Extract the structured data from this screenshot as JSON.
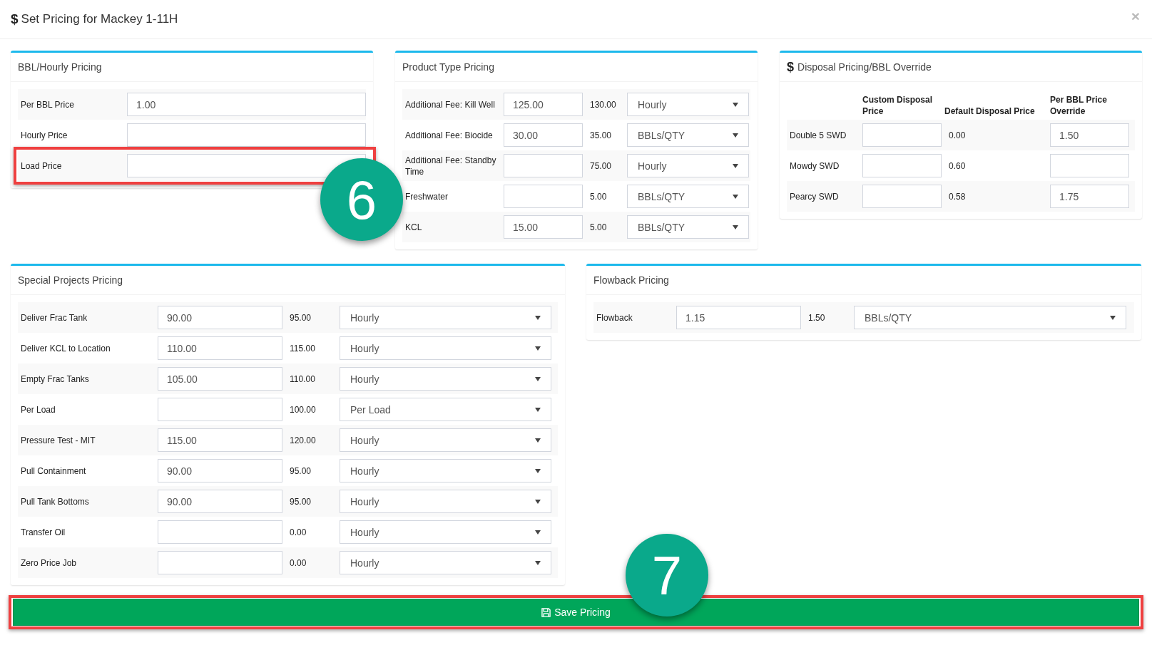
{
  "modal": {
    "title_icon": "$",
    "title": "Set Pricing for Mackey 1-11H",
    "close": "×"
  },
  "bbl_hourly_pricing": {
    "title": "BBL/Hourly Pricing",
    "rows": [
      {
        "label": "Per BBL Price",
        "value": "1.00",
        "highlighted": false
      },
      {
        "label": "Hourly Price",
        "highlighted": false
      },
      {
        "label": "Load Price",
        "highlighted": true
      }
    ]
  },
  "product_type_pricing": {
    "title": "Product Type Pricing",
    "rows": [
      {
        "label": "Additional Fee: Kill Well",
        "value": "125.00",
        "default": "130.00",
        "unit": "Hourly"
      },
      {
        "label": "Additional Fee: Biocide",
        "value": "30.00",
        "default": "35.00",
        "unit": "BBLs/QTY"
      },
      {
        "label": "Additional Fee: Standby Time",
        "default": "75.00",
        "unit": "Hourly"
      },
      {
        "label": "Freshwater",
        "default": "5.00",
        "unit": "BBLs/QTY"
      },
      {
        "label": "KCL",
        "value": "15.00",
        "default": "5.00",
        "unit": "BBLs/QTY"
      }
    ]
  },
  "disposal_pricing": {
    "title_icon": "$",
    "title": "Disposal Pricing/BBL Override",
    "columns": [
      "Custom Disposal Price",
      "Default Disposal Price",
      "Per BBL Price Override"
    ],
    "rows": [
      {
        "name": "Double 5 SWD",
        "default": "0.00",
        "override": "1.50"
      },
      {
        "name": "Mowdy SWD",
        "default": "0.60"
      },
      {
        "name": "Pearcy SWD",
        "default": "0.58",
        "override": "1.75"
      }
    ]
  },
  "special_projects_pricing": {
    "title": "Special Projects Pricing",
    "rows": [
      {
        "label": "Deliver Frac Tank",
        "value": "90.00",
        "default": "95.00",
        "unit": "Hourly"
      },
      {
        "label": "Deliver KCL to Location",
        "value": "110.00",
        "default": "115.00",
        "unit": "Hourly"
      },
      {
        "label": "Empty Frac Tanks",
        "value": "105.00",
        "default": "110.00",
        "unit": "Hourly"
      },
      {
        "label": "Per Load",
        "default": "100.00",
        "unit": "Per Load"
      },
      {
        "label": "Pressure Test - MIT",
        "value": "115.00",
        "default": "120.00",
        "unit": "Hourly"
      },
      {
        "label": "Pull Containment",
        "value": "90.00",
        "default": "95.00",
        "unit": "Hourly"
      },
      {
        "label": "Pull Tank Bottoms",
        "value": "90.00",
        "default": "95.00",
        "unit": "Hourly"
      },
      {
        "label": "Transfer Oil",
        "default": "0.00",
        "unit": "Hourly"
      },
      {
        "label": "Zero Price Job",
        "default": "0.00",
        "unit": "Hourly"
      }
    ]
  },
  "flowback_pricing": {
    "title": "Flowback Pricing",
    "rows": [
      {
        "label": "Flowback",
        "value": "1.15",
        "default": "1.50",
        "unit": "BBLs/QTY"
      }
    ]
  },
  "save_button": {
    "label": "Save Pricing",
    "highlighted": true
  },
  "callouts": [
    {
      "number": "6"
    },
    {
      "number": "7"
    }
  ]
}
